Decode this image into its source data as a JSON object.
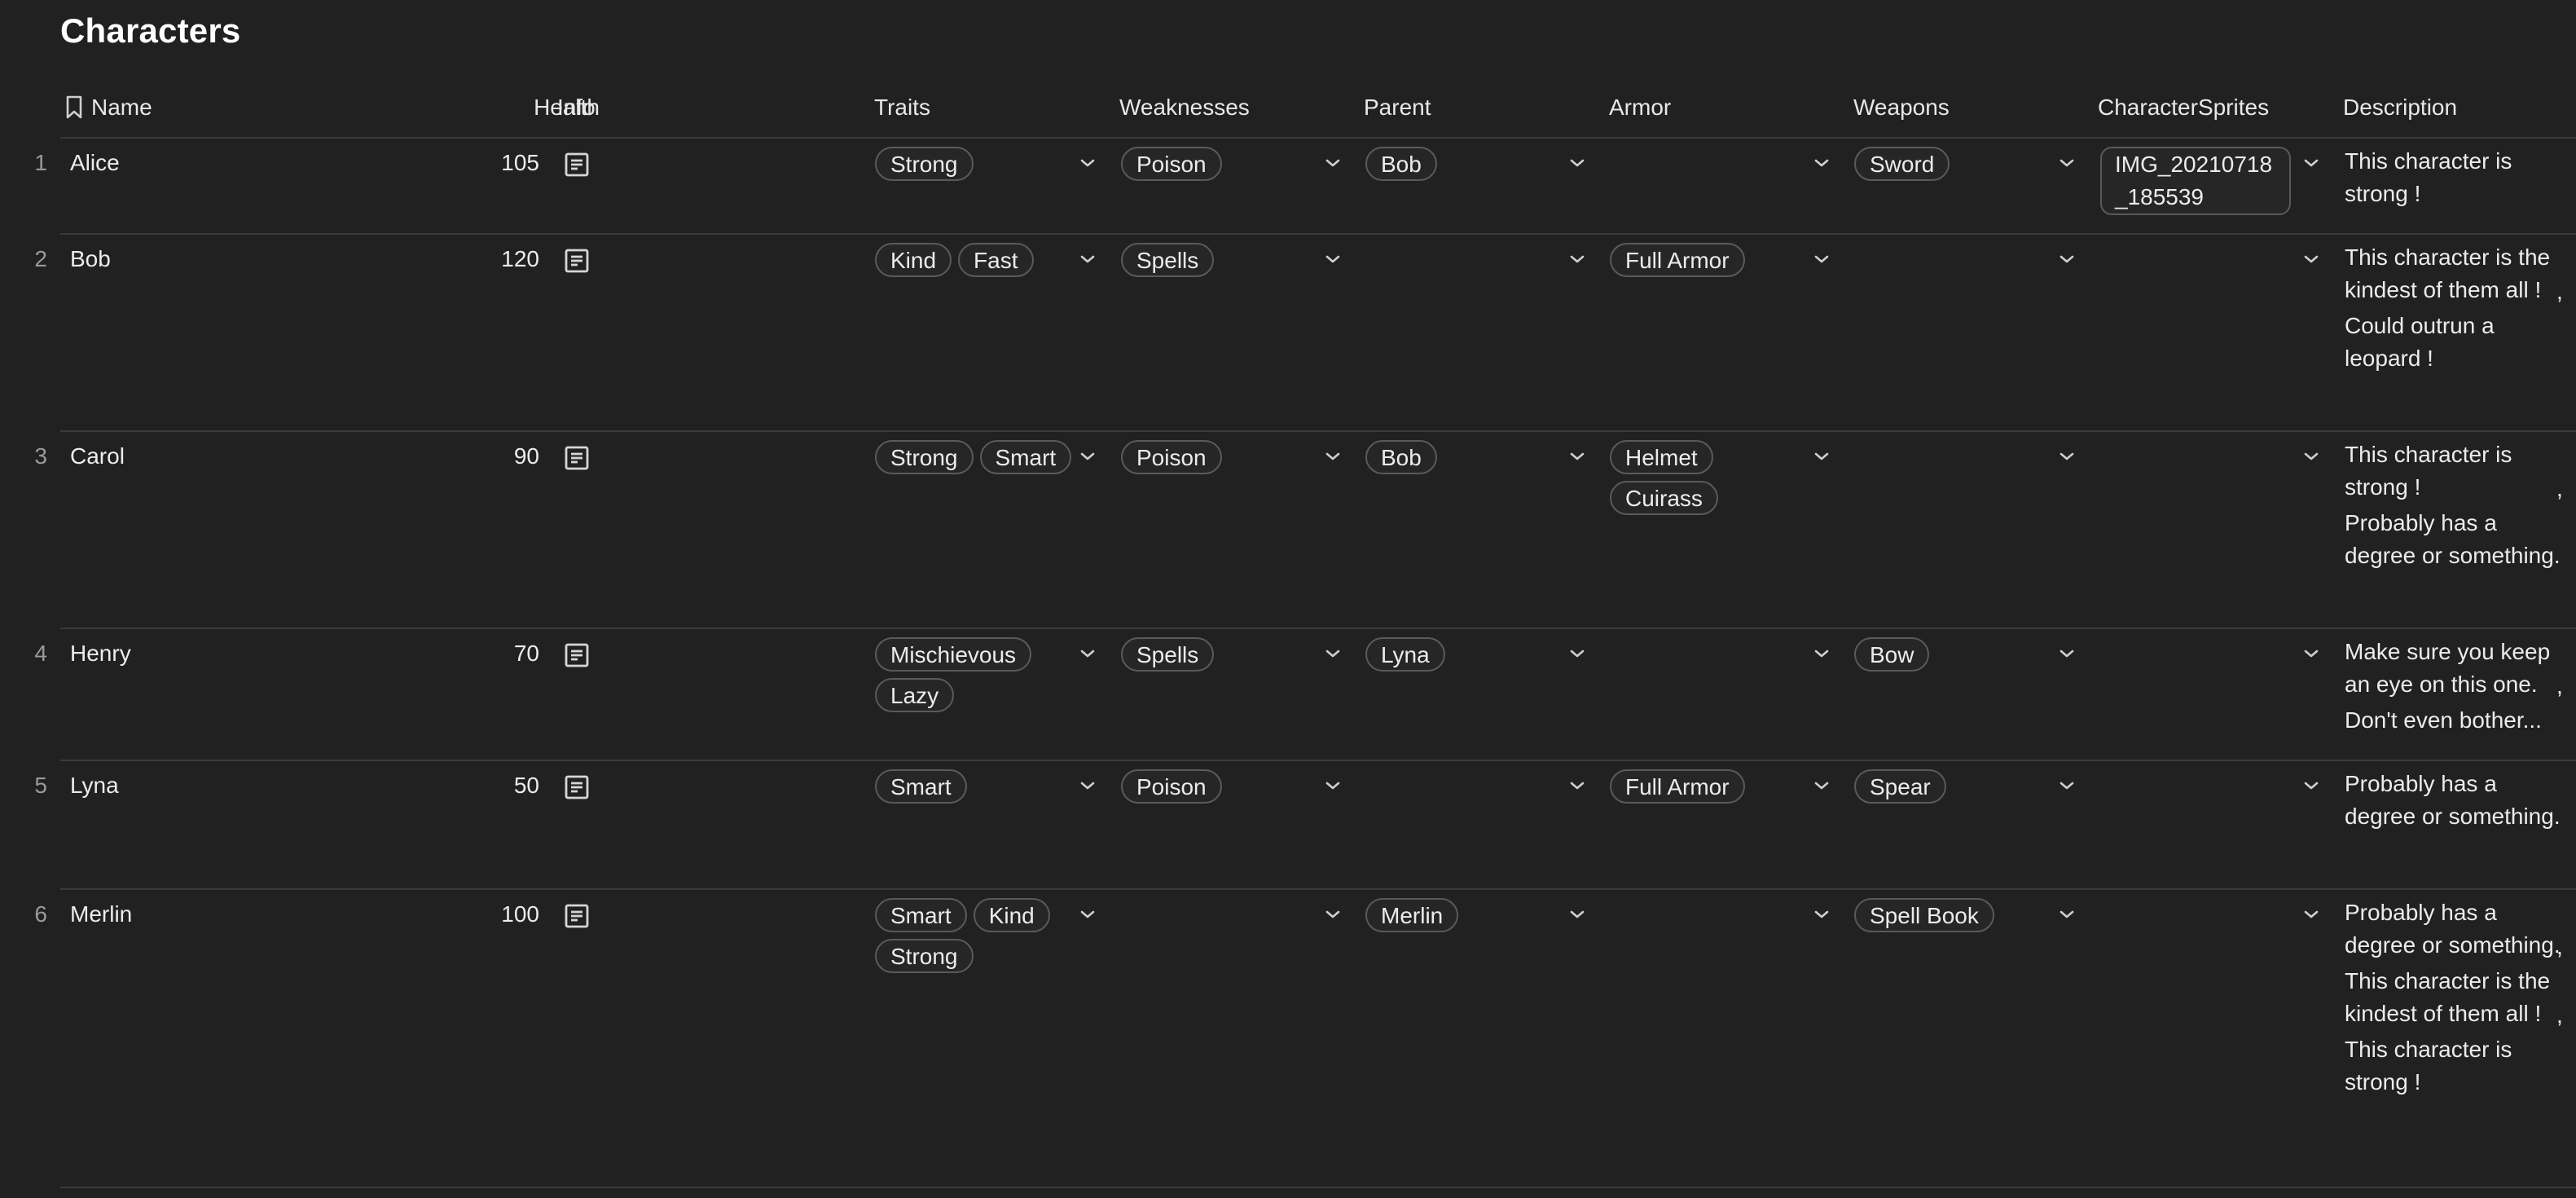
{
  "page_title": "Characters",
  "columns": {
    "name": "Name",
    "health": "Health",
    "info": "Info",
    "traits": "Traits",
    "weaknesses": "Weaknesses",
    "parent": "Parent",
    "armor": "Armor",
    "weapons": "Weapons",
    "sprites": "CharacterSprites",
    "description": "Description"
  },
  "icons": {
    "header_name": "bookmark-icon",
    "info": "document-icon",
    "dropdown": "chevron-down-icon"
  },
  "rows": [
    {
      "num": "1",
      "name": "Alice",
      "health": "105",
      "traits": [
        "Strong"
      ],
      "weaknesses": [
        "Poison"
      ],
      "parent": [
        "Bob"
      ],
      "armor": [],
      "weapons": [
        "Sword"
      ],
      "sprites": [
        "IMG_20210718 _185539"
      ],
      "description": [
        "This character is strong !"
      ]
    },
    {
      "num": "2",
      "name": "Bob",
      "health": "120",
      "traits": [
        "Kind",
        "Fast"
      ],
      "weaknesses": [
        "Spells"
      ],
      "parent": [],
      "armor": [
        "Full Armor"
      ],
      "weapons": [],
      "sprites": [],
      "description": [
        "This character is the kindest of them all !",
        "Could outrun a leopard !"
      ]
    },
    {
      "num": "3",
      "name": "Carol",
      "health": "90",
      "traits": [
        "Strong",
        "Smart"
      ],
      "weaknesses": [
        "Poison"
      ],
      "parent": [
        "Bob"
      ],
      "armor": [
        "Helmet",
        "Cuirass"
      ],
      "weapons": [],
      "sprites": [],
      "description": [
        "This character is strong !",
        "Probably has a degree or something."
      ]
    },
    {
      "num": "4",
      "name": "Henry",
      "health": "70",
      "traits": [
        "Mischievous",
        "Lazy"
      ],
      "weaknesses": [
        "Spells"
      ],
      "parent": [
        "Lyna"
      ],
      "armor": [],
      "weapons": [
        "Bow"
      ],
      "sprites": [],
      "description": [
        "Make sure you keep an eye on this one.",
        "Don't even bother..."
      ]
    },
    {
      "num": "5",
      "name": "Lyna",
      "health": "50",
      "traits": [
        "Smart"
      ],
      "weaknesses": [
        "Poison"
      ],
      "parent": [],
      "armor": [
        "Full Armor"
      ],
      "weapons": [
        "Spear"
      ],
      "sprites": [],
      "description": [
        "Probably has a degree or something."
      ]
    },
    {
      "num": "6",
      "name": "Merlin",
      "health": "100",
      "traits": [
        "Smart",
        "Kind",
        "Strong"
      ],
      "weaknesses": [],
      "parent": [
        "Merlin"
      ],
      "armor": [],
      "weapons": [
        "Spell Book"
      ],
      "sprites": [],
      "description": [
        "Probably has a degree or something.",
        "This character is the kindest of them all !",
        "This character is strong !"
      ]
    }
  ]
}
